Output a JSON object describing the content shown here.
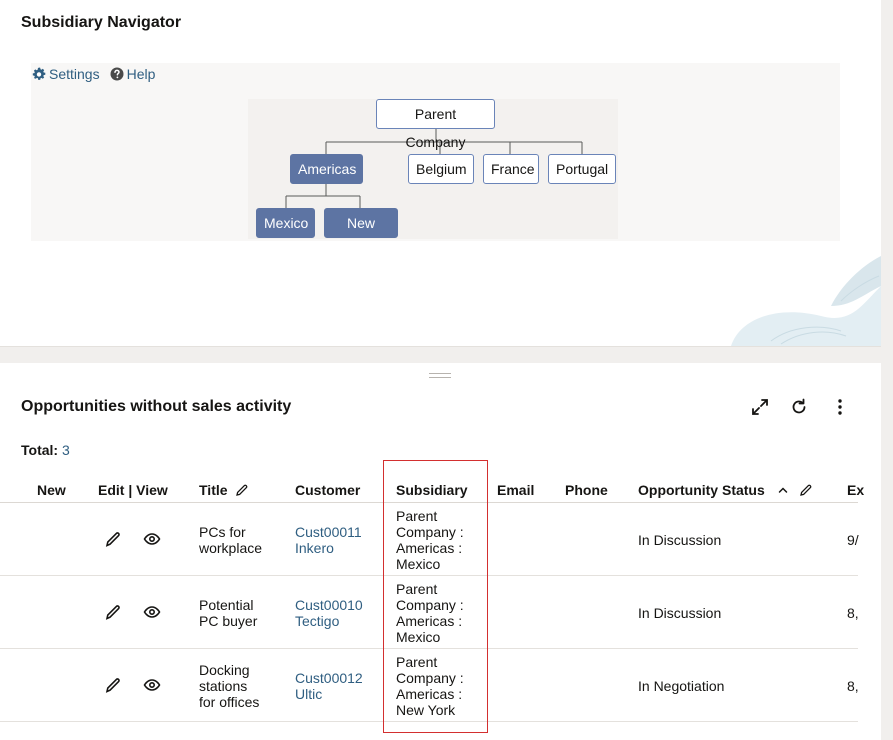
{
  "navigator": {
    "title": "Subsidiary Navigator",
    "settings_label": "Settings",
    "help_label": "Help",
    "nodes": {
      "root": "Parent Company",
      "americas": "Americas",
      "belgium": "Belgium",
      "france": "France",
      "portugal": "Portugal",
      "mexico": "Mexico",
      "newyork": "New York"
    },
    "selected_color": "#5d74a3"
  },
  "opportunities": {
    "title": "Opportunities without sales activity",
    "total_label": "Total:",
    "total_value": "3",
    "columns": [
      "New",
      "Edit | View",
      "Title",
      "Customer",
      "Subsidiary",
      "Email",
      "Phone",
      "Opportunity Status",
      "Ex"
    ],
    "rows": [
      {
        "title_lines": [
          "PCs for",
          "workplace"
        ],
        "customer_id": "Cust00011",
        "customer_name": "Inkero",
        "subsidiary_lines": [
          "Parent",
          "Company :",
          "Americas :",
          "Mexico"
        ],
        "status": "In Discussion",
        "extra": "9/"
      },
      {
        "title_lines": [
          "Potential",
          "PC buyer"
        ],
        "customer_id": "Cust00010",
        "customer_name": "Tectigo",
        "subsidiary_lines": [
          "Parent",
          "Company :",
          "Americas :",
          "Mexico"
        ],
        "status": "In Discussion",
        "extra": "8,"
      },
      {
        "title_lines": [
          "Docking",
          "stations",
          "for offices"
        ],
        "customer_id": "Cust00012",
        "customer_name": "Ultic",
        "subsidiary_lines": [
          "Parent",
          "Company :",
          "Americas :",
          "New York"
        ],
        "status": "In Negotiation",
        "extra": "8,"
      }
    ],
    "highlight_color": "#d32f2f",
    "link_color": "#2f5e81"
  }
}
